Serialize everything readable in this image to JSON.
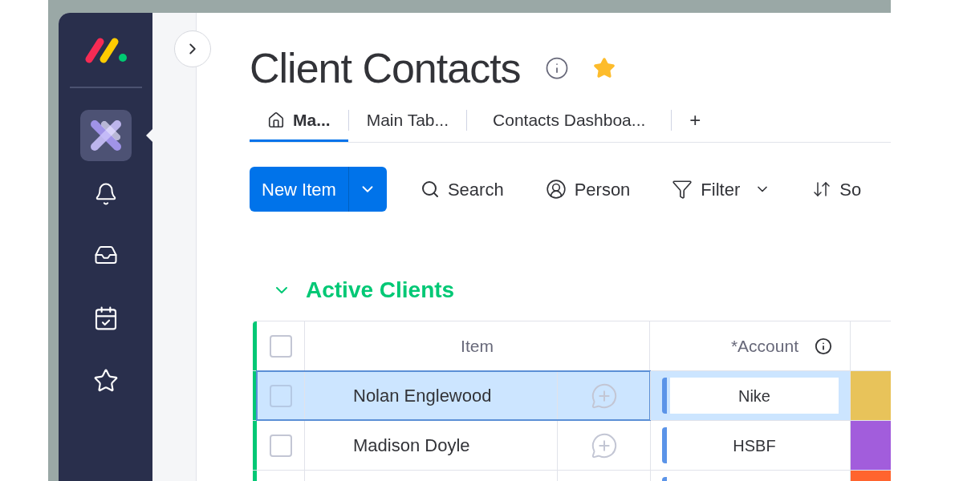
{
  "board": {
    "title": "Client Contacts",
    "starred": true
  },
  "tabs": [
    {
      "label": "Ma...",
      "kind": "home",
      "selected": true
    },
    {
      "label": "Main Tab...",
      "kind": "plain",
      "selected": false
    },
    {
      "label": "Contacts Dashboa...",
      "kind": "plain",
      "selected": false
    },
    {
      "label": "+",
      "kind": "add",
      "selected": false
    }
  ],
  "toolbar": {
    "new_item": "New Item",
    "tools": [
      {
        "label": "Search",
        "kind": "search"
      },
      {
        "label": "Person",
        "kind": "person"
      },
      {
        "label": "Filter",
        "kind": "filter"
      },
      {
        "label": "So",
        "kind": "sort"
      }
    ]
  },
  "group": {
    "title": "Active Clients",
    "expanded": true,
    "color": "#00c875",
    "columns": [
      "Item",
      "*Account"
    ],
    "all_checked": false,
    "rows": [
      {
        "name": "Nolan Englewood",
        "account": "Nike",
        "selected": true,
        "checked": false,
        "color": "#e8c35a"
      },
      {
        "name": "Madison Doyle",
        "account": "HSBF",
        "selected": false,
        "checked": false,
        "color": "#a25ddc"
      },
      {
        "selected": false,
        "color": "#ff642e"
      }
    ]
  }
}
